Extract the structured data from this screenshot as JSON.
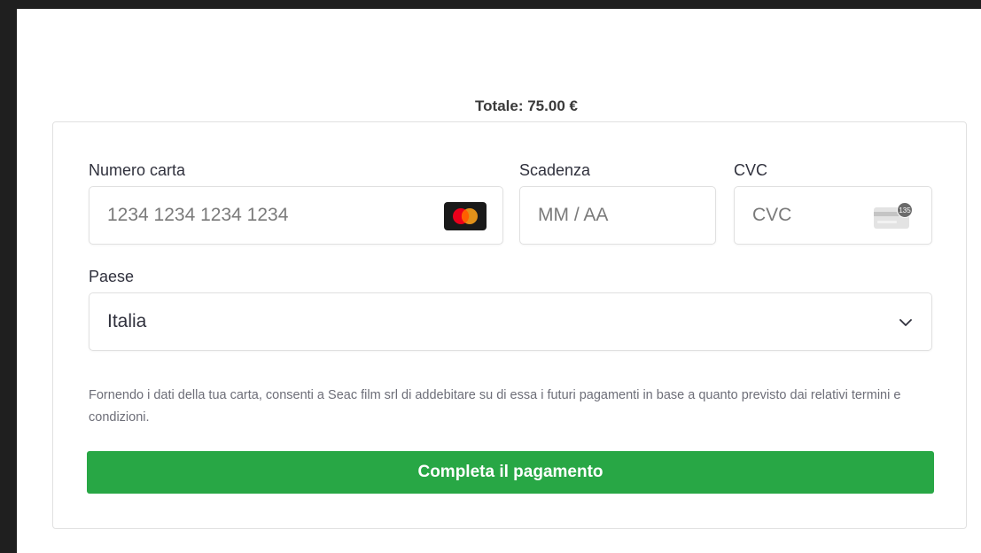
{
  "summary": {
    "total": "Totale: 75.00 €"
  },
  "form": {
    "card_number": {
      "label": "Numero carta",
      "placeholder": "1234 1234 1234 1234",
      "icon": "mastercard-icon"
    },
    "expiry": {
      "label": "Scadenza",
      "placeholder": "MM / AA"
    },
    "cvc": {
      "label": "CVC",
      "placeholder": "CVC",
      "icon": "cvc-card-icon",
      "icon_text": "135"
    },
    "country": {
      "label": "Paese",
      "value": "Italia",
      "icon": "chevron-down-icon"
    },
    "disclaimer": "Fornendo i dati della tua carta, consenti a Seac film srl di addebitare su di essa i futuri pagamenti in base a quanto previsto dai relativi termini e condizioni.",
    "submit_label": "Completa il pagamento"
  },
  "colors": {
    "button": "#28a745",
    "button_text": "#ffffff",
    "border": "#e0e0e0",
    "mastercard_red": "#eb001b",
    "mastercard_yellow": "#f79e1b"
  }
}
